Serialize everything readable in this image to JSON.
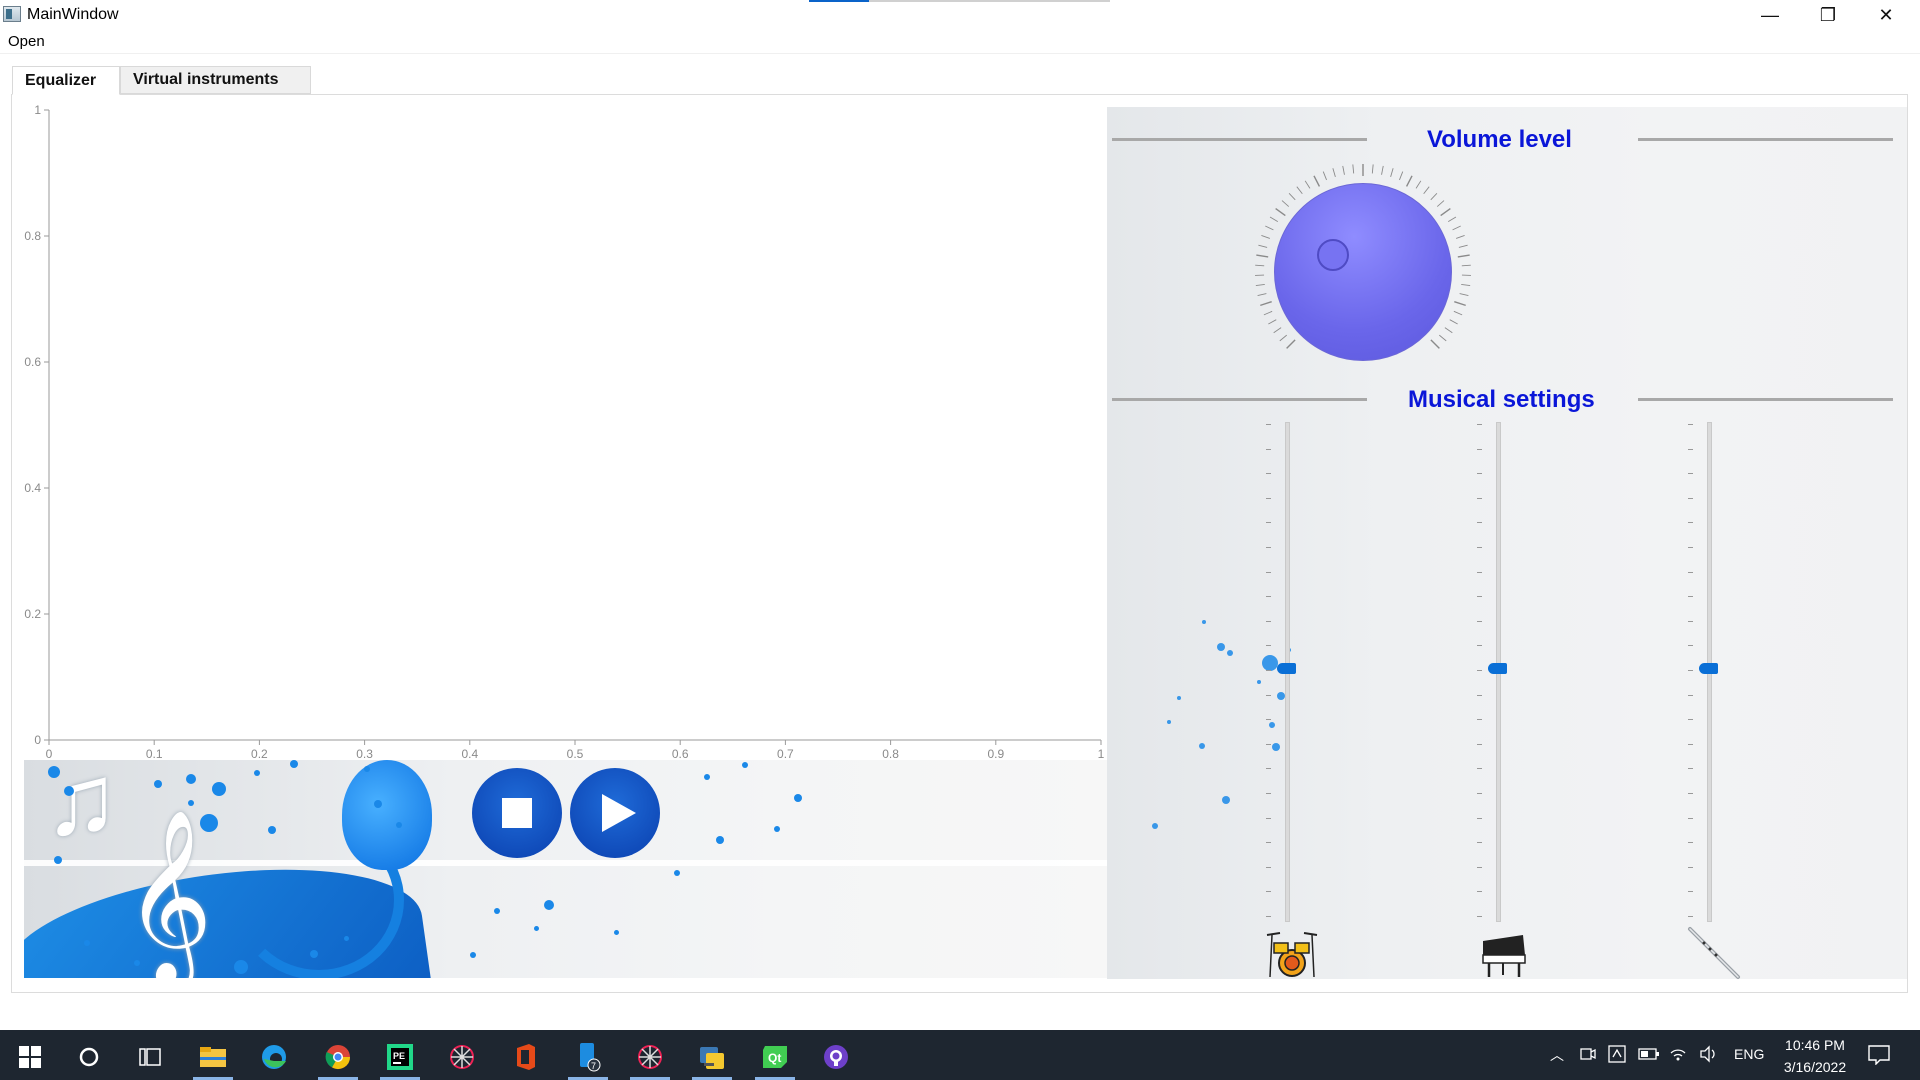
{
  "window": {
    "title": "MainWindow",
    "minimize": "—",
    "maximize": "❐",
    "close": "✕"
  },
  "menu": {
    "items": [
      "Open"
    ]
  },
  "tabs": [
    {
      "label": "Equalizer",
      "active": true
    },
    {
      "label": "Virtual instruments",
      "active": false
    }
  ],
  "chart_data": {
    "type": "line",
    "title": "",
    "xlabel": "",
    "ylabel": "",
    "xlim": [
      0,
      1
    ],
    "ylim": [
      0,
      1
    ],
    "xticks": [
      "0",
      "0.1",
      "0.2",
      "0.3",
      "0.4",
      "0.5",
      "0.6",
      "0.7",
      "0.8",
      "0.9",
      "1"
    ],
    "yticks": [
      "0",
      "0.2",
      "0.4",
      "0.6",
      "0.8",
      "1"
    ],
    "series": [],
    "grid": false
  },
  "controls": {
    "stop_icon": "stop-icon",
    "play_icon": "play-icon"
  },
  "panel": {
    "volume_title": "Volume level",
    "musical_title": "Musical settings",
    "sliders": [
      {
        "instrument_icon": "drums-icon"
      },
      {
        "instrument_icon": "piano-icon"
      },
      {
        "instrument_icon": "flute-icon"
      }
    ]
  },
  "taskbar": {
    "icons": [
      "windows-start-icon",
      "search-icon",
      "task-view-icon",
      "file-explorer-icon",
      "edge-icon",
      "chrome-icon",
      "pycharm-icon",
      "app-icon",
      "office-icon",
      "phone-link-icon",
      "app-icon",
      "python-icon",
      "qt-icon",
      "github-icon"
    ],
    "badge": "7",
    "language": "ENG",
    "time": "10:46 PM",
    "date": "3/16/2022"
  },
  "colors": {
    "accent": "#0a16d8",
    "knob": "#7773f2",
    "slider_handle": "#0a6fd6",
    "banner_blue": "#1a88e8"
  }
}
